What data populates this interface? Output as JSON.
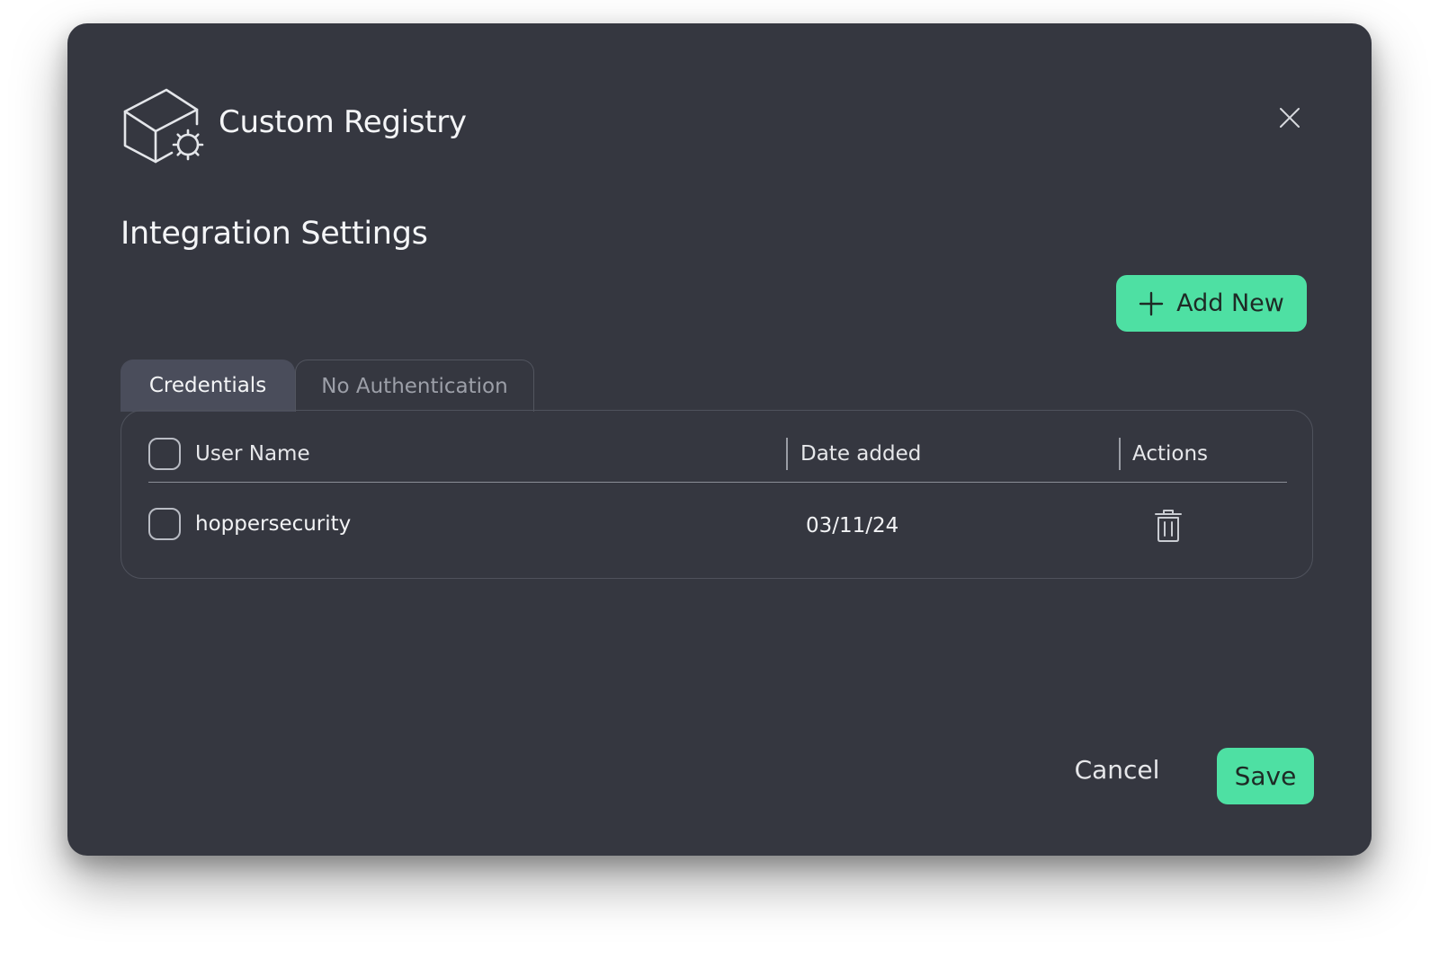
{
  "header": {
    "title": "Custom Registry",
    "logo_icon": "package-gear-icon",
    "close_icon": "close-icon"
  },
  "section": {
    "title": "Integration Settings"
  },
  "toolbar": {
    "add_label": "Add New",
    "add_icon": "plus-icon"
  },
  "tabs": [
    {
      "label": "Credentials",
      "active": true
    },
    {
      "label": "No Authentication",
      "active": false
    }
  ],
  "table": {
    "columns": [
      "User Name",
      "Date added",
      "Actions"
    ],
    "rows": [
      {
        "user_name": "hoppersecurity",
        "date_added": "03/11/24",
        "action_icon": "trash-icon"
      }
    ]
  },
  "footer": {
    "cancel_label": "Cancel",
    "save_label": "Save"
  },
  "colors": {
    "accent": "#4ee0a3",
    "modal_bg": "#353740",
    "active_tab_bg": "#4a4d5b"
  }
}
